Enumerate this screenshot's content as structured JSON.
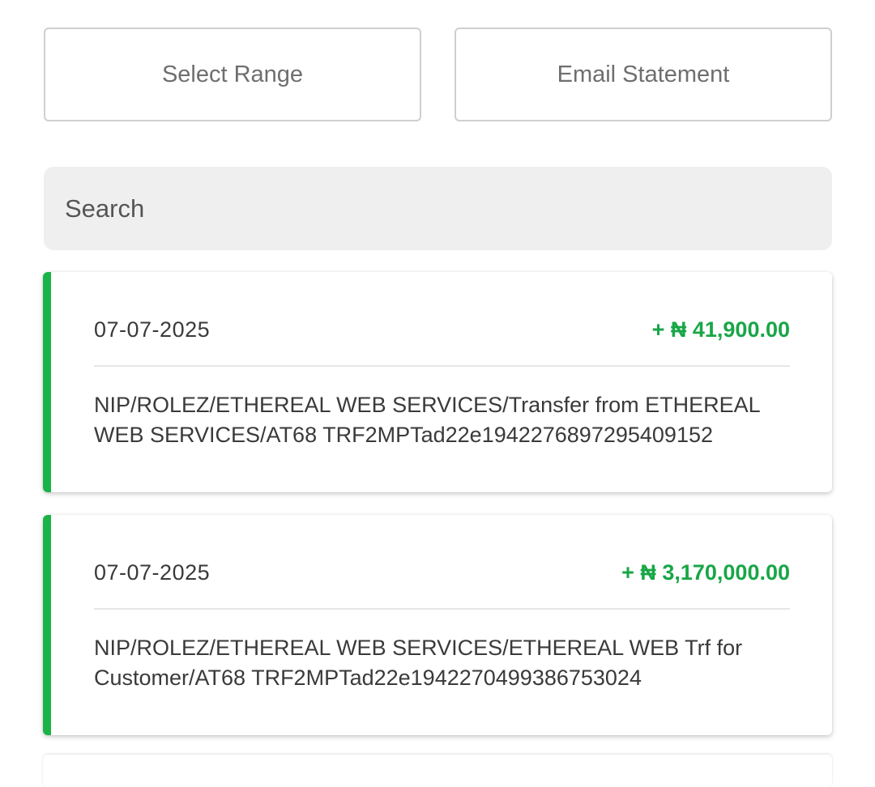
{
  "actions": {
    "select_range_label": "Select Range",
    "email_statement_label": "Email Statement"
  },
  "search": {
    "placeholder": "Search",
    "value": ""
  },
  "transactions": [
    {
      "date": "07-07-2025",
      "amount": "+ ₦ 41,900.00",
      "description": "NIP/ROLEZ/ETHEREAL WEB SERVICES/Transfer from  ETHEREAL WEB SERVICES/AT68 TRF2MPTad22e1942276897295409152"
    },
    {
      "date": "07-07-2025",
      "amount": "+ ₦ 3,170,000.00",
      "description": "NIP/ROLEZ/ETHEREAL WEB SERVICES/ETHEREAL WEB Trf for Customer/AT68 TRF2MPTad22e1942270499386753024"
    }
  ],
  "colors": {
    "credit_accent": "#19b347",
    "credit_amount": "#19a647"
  }
}
